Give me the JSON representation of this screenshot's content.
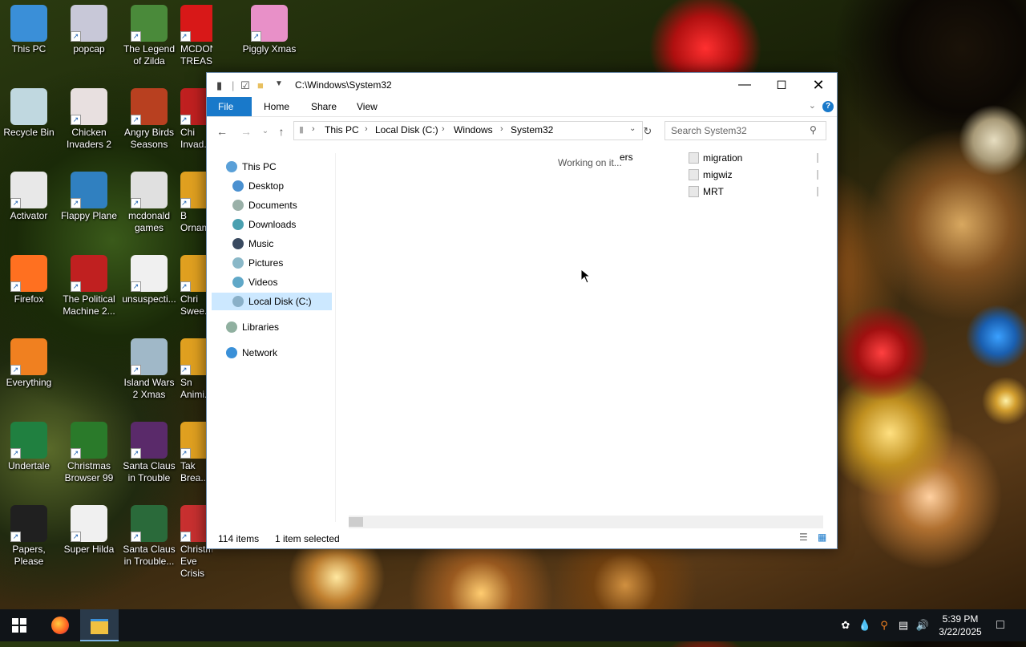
{
  "desktop": {
    "icons": [
      {
        "label": "This PC",
        "color": "#3a8fd8"
      },
      {
        "label": "popcap",
        "color": "#c8c8d8"
      },
      {
        "label": "The Legend of Zilda",
        "color": "#4a8a3a"
      },
      {
        "label": "MCDONAL TREASURE...",
        "color": "#d81818"
      },
      {
        "label": "Piggly Xmas",
        "color": "#e890c8"
      },
      {
        "label": "Recycle Bin",
        "color": "#c0d8e0"
      },
      {
        "label": "Chicken Invaders 2",
        "color": "#e8e0e0"
      },
      {
        "label": "Angry Birds Seasons",
        "color": "#b84020"
      },
      {
        "label": "Chi Invad...",
        "color": "#c02020"
      },
      {
        "label": "Activator",
        "color": "#e8e8e8"
      },
      {
        "label": "Flappy Plane",
        "color": "#3080c0"
      },
      {
        "label": "mcdonald games",
        "color": "#e0e0e0"
      },
      {
        "label": "B Orname...",
        "color": "#e0a020"
      },
      {
        "label": "Firefox",
        "color": "#ff7020"
      },
      {
        "label": "The Political Machine 2...",
        "color": "#c02020"
      },
      {
        "label": "unsuspecti...",
        "color": "#f0f0f0"
      },
      {
        "label": "Chri Swee...",
        "color": "#e0a020"
      },
      {
        "label": "Everything",
        "color": "#f08020"
      },
      {
        "label": "Island Wars 2 Xmas",
        "color": "#a0b8c8"
      },
      {
        "label": "Sn Animi...",
        "color": "#e0a020"
      },
      {
        "label": "Undertale",
        "color": "#208040"
      },
      {
        "label": "Christmas Browser 99",
        "color": "#2a7a2a"
      },
      {
        "label": "Santa Claus in Trouble",
        "color": "#5a2a6a"
      },
      {
        "label": "Tak Brea...",
        "color": "#e0a020"
      },
      {
        "label": "Papers, Please",
        "color": "#202020"
      },
      {
        "label": "Super Hilda",
        "color": "#f0f0f0"
      },
      {
        "label": "Santa Claus in Trouble...",
        "color": "#2a6a3a"
      },
      {
        "label": "Christmas Eve Crisis",
        "color": "#c83030"
      }
    ]
  },
  "window": {
    "title_path": "C:\\Windows\\System32",
    "ribbon_tabs": [
      "File",
      "Home",
      "Share",
      "View"
    ],
    "help": "?",
    "breadcrumb": [
      "This PC",
      "Local Disk (C:)",
      "Windows",
      "System32"
    ],
    "search_placeholder": "Search System32",
    "nav": [
      {
        "label": "This PC",
        "color": "#5aa0d8"
      },
      {
        "label": "Desktop",
        "color": "#4a90d0"
      },
      {
        "label": "Documents",
        "color": "#9ab0a8"
      },
      {
        "label": "Downloads",
        "color": "#4aa0b0"
      },
      {
        "label": "Music",
        "color": "#3a4a60"
      },
      {
        "label": "Pictures",
        "color": "#8ab8c8"
      },
      {
        "label": "Videos",
        "color": "#60a8c8"
      },
      {
        "label": "Local Disk (C:)",
        "color": "#8ab0c8"
      },
      {
        "label": "Libraries",
        "color": "#90b0a0"
      },
      {
        "label": "Network",
        "color": "#3a90d8"
      }
    ],
    "working_text": "Working on it...",
    "partial_text": "ers",
    "folders": [
      "migration",
      "migwiz",
      "MRT"
    ],
    "status": {
      "items": "114 items",
      "selected": "1 item selected"
    }
  },
  "taskbar": {
    "time": "5:39 PM",
    "date": "3/22/2025"
  }
}
